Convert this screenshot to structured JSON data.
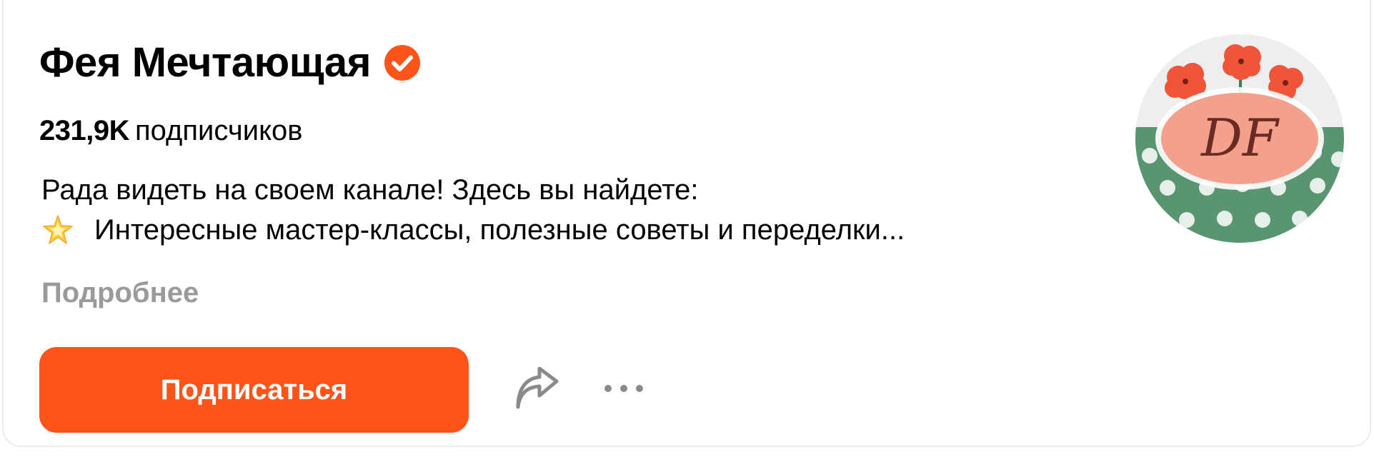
{
  "channel": {
    "name": "Фея Мечтающая",
    "verified": true,
    "subscribers_count": "231,9K",
    "subscribers_label": "подписчиков",
    "description_line1": "Рада видеть на своем канале! Здесь вы найдете:",
    "description_line2": "Интересные мастер-классы, полезные советы и переделки...",
    "description_emoji": "star-icon",
    "more_label": "Подробнее",
    "avatar_text": "DF"
  },
  "actions": {
    "subscribe_label": "Подписаться",
    "share_icon": "share-icon",
    "more_icon": "more-dots-icon"
  },
  "colors": {
    "accent": "#ff5419",
    "verified_badge": "#ff5419",
    "muted_text": "#9a9a9a",
    "avatar_green": "#5a9572",
    "avatar_pink": "#f3a08c",
    "avatar_flower": "#f0553a"
  }
}
